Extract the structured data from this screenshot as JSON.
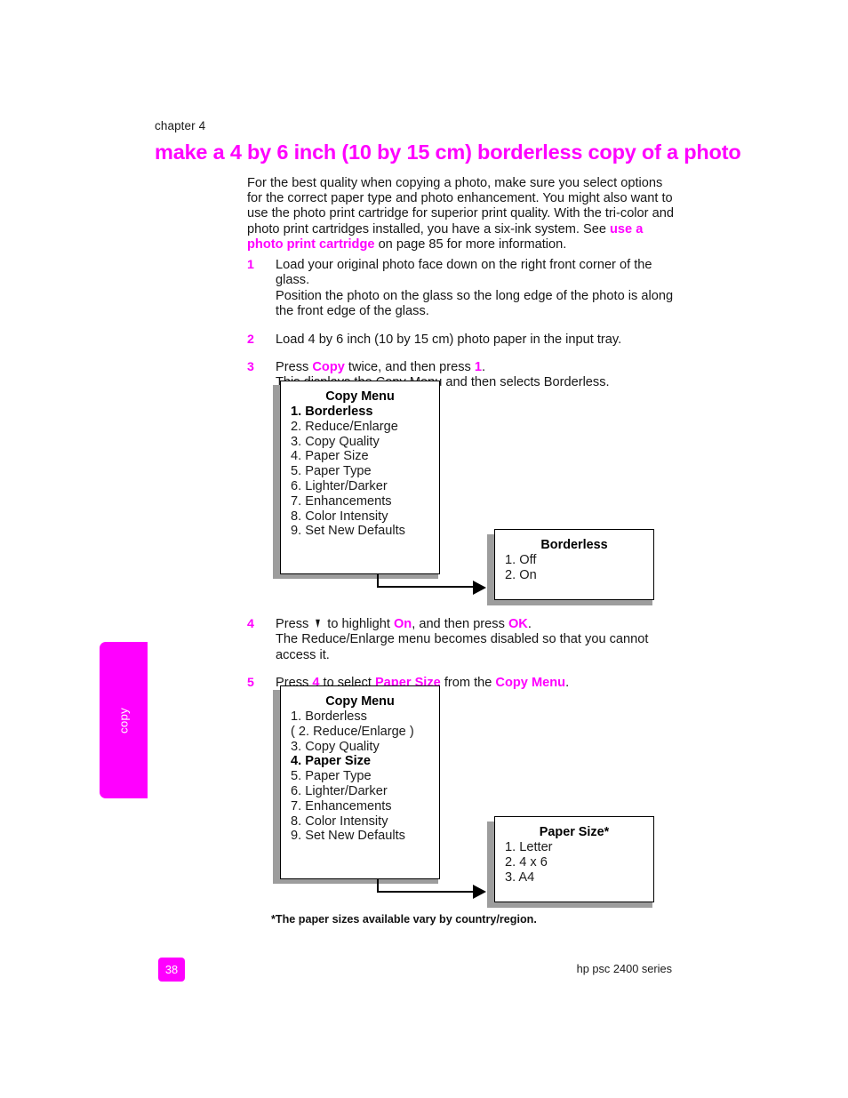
{
  "header": {
    "chapter_label": "chapter 4",
    "title": "make a 4 by 6 inch (10 by 15 cm) borderless copy of a photo"
  },
  "intro": {
    "part1": "For the best quality when copying a photo, make sure you select options for the correct paper type and photo enhancement. You might also want to use the photo print cartridge for superior print quality. With the tri-color and photo print cartridges installed, you have a six-ink system. See ",
    "link": "use a photo print cartridge",
    "part2": " on page 85 for more information."
  },
  "steps": {
    "step1": {
      "num": "1",
      "line1": "Load your original photo face down on the right front corner of the glass.",
      "line2": "Position the photo on the glass so the long edge of the photo is along the front edge of the glass."
    },
    "step2": {
      "num": "2",
      "line1": "Load 4 by 6 inch (10 by 15 cm) photo paper in the input tray."
    },
    "step3": {
      "num": "3",
      "pre": "Press ",
      "kw1": "Copy",
      "mid": " twice, and then press ",
      "kw2": "1",
      "post": ".",
      "line2": "This displays the Copy Menu and then selects Borderless."
    },
    "step4": {
      "num": "4",
      "pre": "Press ",
      "arrow": "▼",
      "mid1": " to highlight ",
      "kw1": "On",
      "mid2": ", and then press ",
      "kw2": "OK",
      "post": ".",
      "line2": "The Reduce/Enlarge menu becomes disabled so that you cannot access it."
    },
    "step5": {
      "num": "5",
      "pre": "Press ",
      "kw1": "4",
      "mid1": " to select ",
      "kw2": "Paper Size",
      "mid2": " from the ",
      "kw3": "Copy Menu",
      "post": "."
    }
  },
  "menus": {
    "copy_menu_1": {
      "title": "Copy Menu",
      "items": [
        {
          "label": "1. Borderless",
          "bold": true
        },
        {
          "label": "2. Reduce/Enlarge",
          "bold": false
        },
        {
          "label": "3. Copy Quality",
          "bold": false
        },
        {
          "label": "4. Paper Size",
          "bold": false
        },
        {
          "label": "5. Paper Type",
          "bold": false
        },
        {
          "label": "6. Lighter/Darker",
          "bold": false
        },
        {
          "label": "7. Enhancements",
          "bold": false
        },
        {
          "label": "8. Color Intensity",
          "bold": false
        },
        {
          "label": "9. Set New Defaults",
          "bold": false
        }
      ]
    },
    "borderless": {
      "title": "Borderless",
      "items": [
        {
          "label": "1. Off",
          "bold": false
        },
        {
          "label": "2. On",
          "bold": false
        }
      ]
    },
    "copy_menu_2": {
      "title": "Copy Menu",
      "items": [
        {
          "label": "1. Borderless",
          "bold": false
        },
        {
          "label": "( 2. Reduce/Enlarge )",
          "bold": false
        },
        {
          "label": "3. Copy Quality",
          "bold": false
        },
        {
          "label": "4. Paper Size",
          "bold": true
        },
        {
          "label": "5. Paper Type",
          "bold": false
        },
        {
          "label": "6. Lighter/Darker",
          "bold": false
        },
        {
          "label": "7. Enhancements",
          "bold": false
        },
        {
          "label": "8. Color Intensity",
          "bold": false
        },
        {
          "label": "9. Set New Defaults",
          "bold": false
        }
      ]
    },
    "paper_size": {
      "title": "Paper Size*",
      "items": [
        {
          "label": "1. Letter",
          "bold": false
        },
        {
          "label": "2. 4 x 6",
          "bold": false
        },
        {
          "label": "3. A4",
          "bold": false
        }
      ]
    }
  },
  "footnote": "*The paper sizes available vary by country/region.",
  "side_tab": {
    "label": "copy"
  },
  "footer": {
    "page_number": "38",
    "product": "hp psc 2400 series"
  },
  "colors": {
    "accent": "#ff00ff",
    "text": "#161616",
    "shadow": "#9d9d9d"
  }
}
